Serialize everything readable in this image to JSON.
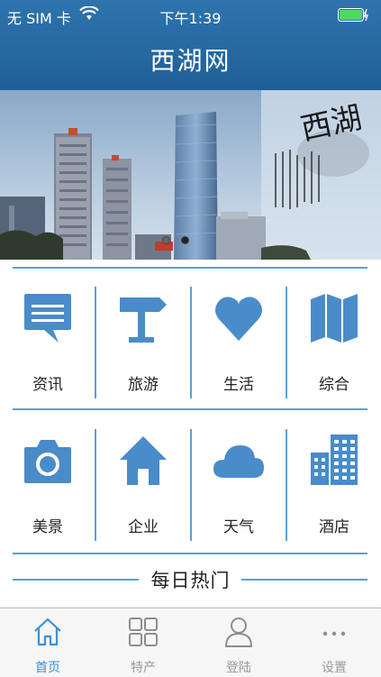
{
  "status_bar": {
    "carrier": "无 SIM 卡",
    "time": "下午1:39"
  },
  "header": {
    "title": "西湖网"
  },
  "banner": {
    "calligraphy": "西湖",
    "slide_count": 2,
    "active_slide": 1
  },
  "grid": {
    "rows": [
      [
        {
          "label": "资讯",
          "icon": "chat-bubble-icon"
        },
        {
          "label": "旅游",
          "icon": "signpost-icon"
        },
        {
          "label": "生活",
          "icon": "heart-icon"
        },
        {
          "label": "综合",
          "icon": "map-icon"
        }
      ],
      [
        {
          "label": "美景",
          "icon": "camera-icon"
        },
        {
          "label": "企业",
          "icon": "home-icon"
        },
        {
          "label": "天气",
          "icon": "cloud-icon"
        },
        {
          "label": "酒店",
          "icon": "building-icon"
        }
      ]
    ]
  },
  "section": {
    "title": "每日热门"
  },
  "tabbar": {
    "items": [
      {
        "label": "首页",
        "icon": "home-outline-icon",
        "active": true
      },
      {
        "label": "特产",
        "icon": "grid-icon",
        "active": false
      },
      {
        "label": "登陆",
        "icon": "user-icon",
        "active": false
      },
      {
        "label": "设置",
        "icon": "more-icon",
        "active": false
      }
    ]
  },
  "colors": {
    "header": "#2667a2",
    "accent": "#5aa0d4",
    "icon": "#4a8bc9",
    "tab_active": "#3d8fd6",
    "battery": "#4cd964"
  }
}
